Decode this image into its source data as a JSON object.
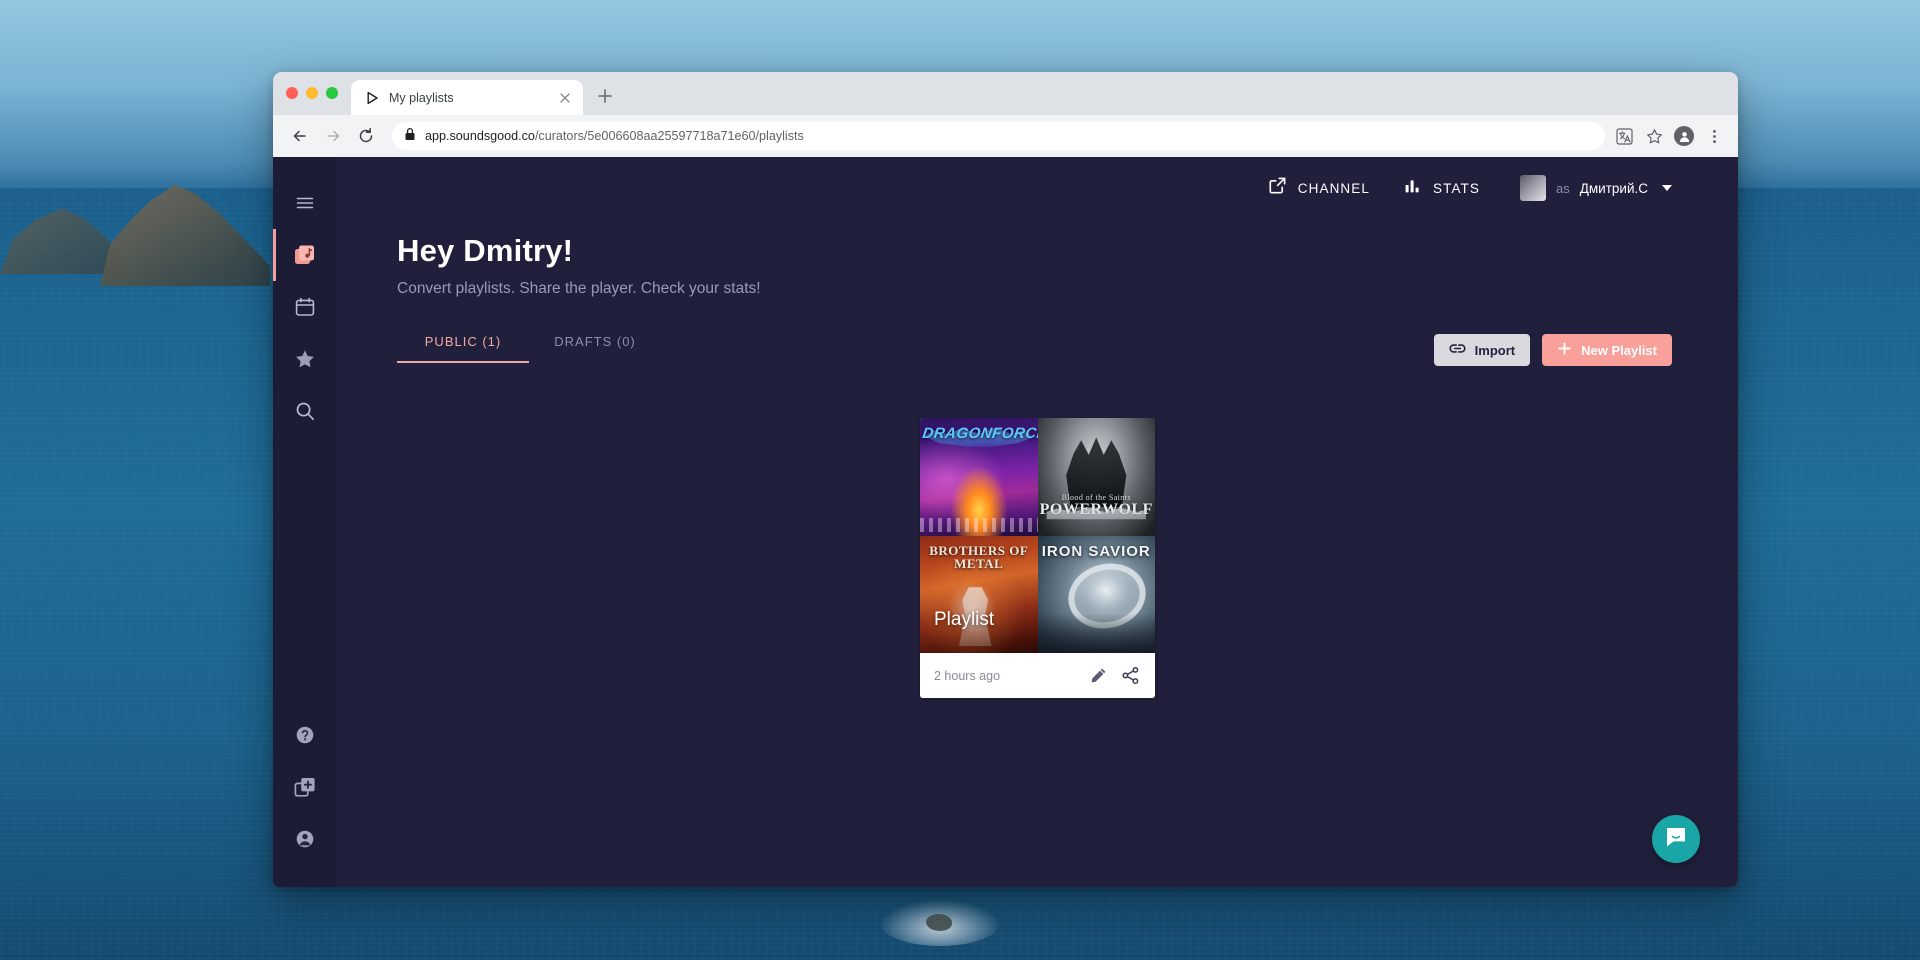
{
  "browser": {
    "tab": {
      "title": "My playlists",
      "favicon_icon": "play-icon",
      "close_icon": "close-icon"
    },
    "new_tab_icon": "plus-icon",
    "nav": {
      "back_icon": "back-arrow-icon",
      "forward_icon": "forward-arrow-icon",
      "reload_icon": "reload-icon"
    },
    "omnibox": {
      "lock_icon": "lock-icon",
      "url_host": "app.soundsgood.co",
      "url_path": "/curators/5e006608aa25597718a71e60/playlists",
      "url_full": "app.soundsgood.co/curators/5e006608aa25597718a71e60/playlists"
    },
    "actions": {
      "translate_icon": "translate-icon",
      "bookmark_icon": "star-icon",
      "profile_icon": "profile-avatar-icon",
      "menu_icon": "three-dot-menu-icon"
    },
    "traffic_lights": [
      "close-red",
      "minimize-yellow",
      "maximize-green"
    ]
  },
  "sidebar": {
    "top_items": [
      {
        "name": "menu",
        "icon": "hamburger-menu-icon",
        "active": false
      },
      {
        "name": "playlists",
        "icon": "music-note-icon",
        "active": true
      },
      {
        "name": "calendar",
        "icon": "calendar-icon",
        "active": false
      },
      {
        "name": "favorites",
        "icon": "star-icon",
        "active": false
      },
      {
        "name": "search",
        "icon": "search-icon",
        "active": false
      }
    ],
    "bottom_items": [
      {
        "name": "help",
        "icon": "question-mark-icon",
        "active": false
      },
      {
        "name": "add-new",
        "icon": "add-square-icon",
        "active": false
      },
      {
        "name": "account",
        "icon": "account-person-icon",
        "active": false
      }
    ]
  },
  "topbar": {
    "channel_label": "CHANNEL",
    "channel_icon": "external-link-icon",
    "stats_label": "STATS",
    "stats_icon": "bar-chart-icon",
    "as_label": "as",
    "user_name": "Дмитрий.С",
    "caret_icon": "chevron-down-icon"
  },
  "hero": {
    "greeting": "Hey Dmitry!",
    "subtitle": "Convert playlists. Share the player. Check your stats!"
  },
  "tabs": [
    {
      "label": "PUBLIC (1)",
      "active": true
    },
    {
      "label": "DRAFTS (0)",
      "active": false
    }
  ],
  "actions": {
    "import_label": "Import",
    "import_icon": "link-icon",
    "new_playlist_label": "New Playlist",
    "new_playlist_icon": "plus-icon"
  },
  "playlists": [
    {
      "title": "Playlist",
      "updated": "2 hours ago",
      "edit_icon": "pencil-icon",
      "share_icon": "share-icon",
      "covers": [
        {
          "artist": "DRAGONFORCE",
          "sub": ""
        },
        {
          "artist": "POWERWOLF",
          "sub": "Blood of the Saints"
        },
        {
          "artist": "BROTHERS OF METAL",
          "sub": ""
        },
        {
          "artist": "IRON SAVIOR",
          "sub": ""
        }
      ]
    }
  ],
  "chat_widget": {
    "icon": "chat-bubble-icon",
    "color": "#1aa6a6"
  },
  "colors": {
    "app_background": "#20203c",
    "sidebar_background": "#1c1c36",
    "accent": "#f8a099",
    "muted_text": "#9a9ab4",
    "card_background": "#ffffff"
  }
}
